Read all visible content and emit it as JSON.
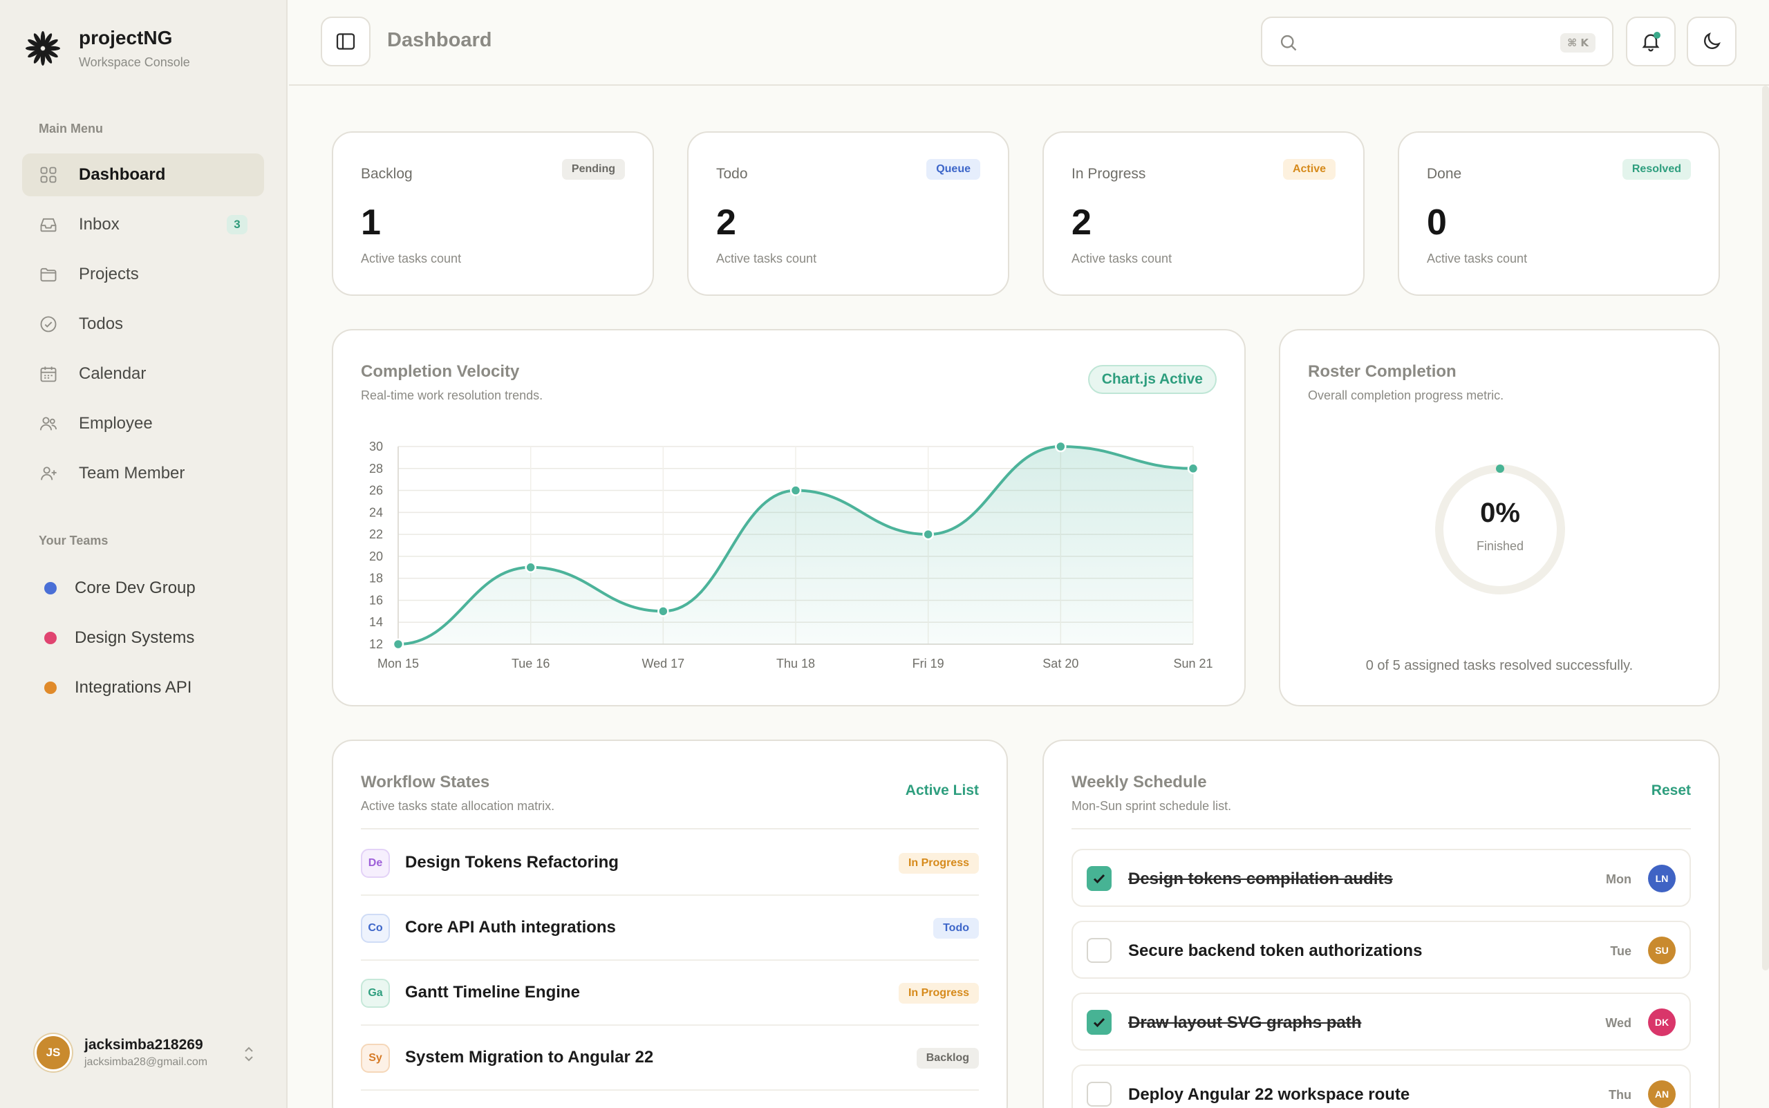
{
  "brand": {
    "name": "projectNG",
    "subtitle": "Workspace Console"
  },
  "sidebar": {
    "main_menu_label": "Main Menu",
    "items": [
      {
        "label": "Dashboard",
        "icon": "grid-icon",
        "active": true
      },
      {
        "label": "Inbox",
        "icon": "inbox-icon",
        "badge": "3"
      },
      {
        "label": "Projects",
        "icon": "folder-icon"
      },
      {
        "label": "Todos",
        "icon": "check-circle-icon"
      },
      {
        "label": "Calendar",
        "icon": "calendar-icon"
      },
      {
        "label": "Employee",
        "icon": "users-icon"
      },
      {
        "label": "Team Member",
        "icon": "user-plus-icon"
      }
    ],
    "teams_label": "Your Teams",
    "teams": [
      {
        "label": "Core Dev Group",
        "color": "#4a6fd6"
      },
      {
        "label": "Design Systems",
        "color": "#e04470"
      },
      {
        "label": "Integrations API",
        "color": "#e08a2a"
      }
    ],
    "user": {
      "initials": "JS",
      "name": "jacksimba218269",
      "email": "jacksimba28@gmail.com"
    }
  },
  "header": {
    "title": "Dashboard",
    "search": {
      "value": "",
      "placeholder": "",
      "shortcut": "⌘ K"
    }
  },
  "stats": [
    {
      "label": "Backlog",
      "pill": "Pending",
      "value": "1",
      "sub": "Active tasks count"
    },
    {
      "label": "Todo",
      "pill": "Queue",
      "value": "2",
      "sub": "Active tasks count"
    },
    {
      "label": "In Progress",
      "pill": "Active",
      "value": "2",
      "sub": "Active tasks count"
    },
    {
      "label": "Done",
      "pill": "Resolved",
      "value": "0",
      "sub": "Active tasks count"
    }
  ],
  "velocity": {
    "title": "Completion Velocity",
    "subtitle": "Real-time work resolution trends.",
    "badge": "Chart.js Active"
  },
  "chart_data": {
    "type": "area",
    "categories": [
      "Mon 15",
      "Tue 16",
      "Wed 17",
      "Thu 18",
      "Fri 19",
      "Sat 20",
      "Sun 21"
    ],
    "values": [
      12,
      19,
      15,
      26,
      22,
      30,
      28
    ],
    "ylim": [
      12,
      30
    ],
    "yticks": [
      12,
      14,
      16,
      18,
      20,
      22,
      24,
      26,
      28,
      30
    ],
    "grid": true,
    "color": "#4cb39a"
  },
  "roster": {
    "title": "Roster Completion",
    "subtitle": "Overall completion progress metric.",
    "percent_label": "0%",
    "percent_value": 0,
    "finished_label": "Finished",
    "footer": "0 of 5 assigned tasks resolved successfully."
  },
  "workflow": {
    "title": "Workflow States",
    "subtitle": "Active tasks state allocation matrix.",
    "action": "Active List",
    "rows": [
      {
        "abbr": "De",
        "title": "Design Tokens Refactoring",
        "status": "In Progress"
      },
      {
        "abbr": "Co",
        "title": "Core API Auth integrations",
        "status": "Todo"
      },
      {
        "abbr": "Ga",
        "title": "Gantt Timeline Engine",
        "status": "In Progress"
      },
      {
        "abbr": "Sy",
        "title": "System Migration to Angular 22",
        "status": "Backlog"
      }
    ]
  },
  "schedule": {
    "title": "Weekly Schedule",
    "subtitle": "Mon-Sun sprint schedule list.",
    "action": "Reset",
    "rows": [
      {
        "title": "Design tokens compilation audits",
        "day": "Mon",
        "initials": "LN",
        "done": true,
        "color": "#3f63c4"
      },
      {
        "title": "Secure backend token authorizations",
        "day": "Tue",
        "initials": "SU",
        "done": false,
        "color": "#c98a2e"
      },
      {
        "title": "Draw layout SVG graphs path",
        "day": "Wed",
        "initials": "DK",
        "done": true,
        "color": "#d9366a"
      },
      {
        "title": "Deploy Angular 22 workspace route",
        "day": "Thu",
        "initials": "AN",
        "done": false,
        "color": "#c98a2e"
      }
    ]
  }
}
